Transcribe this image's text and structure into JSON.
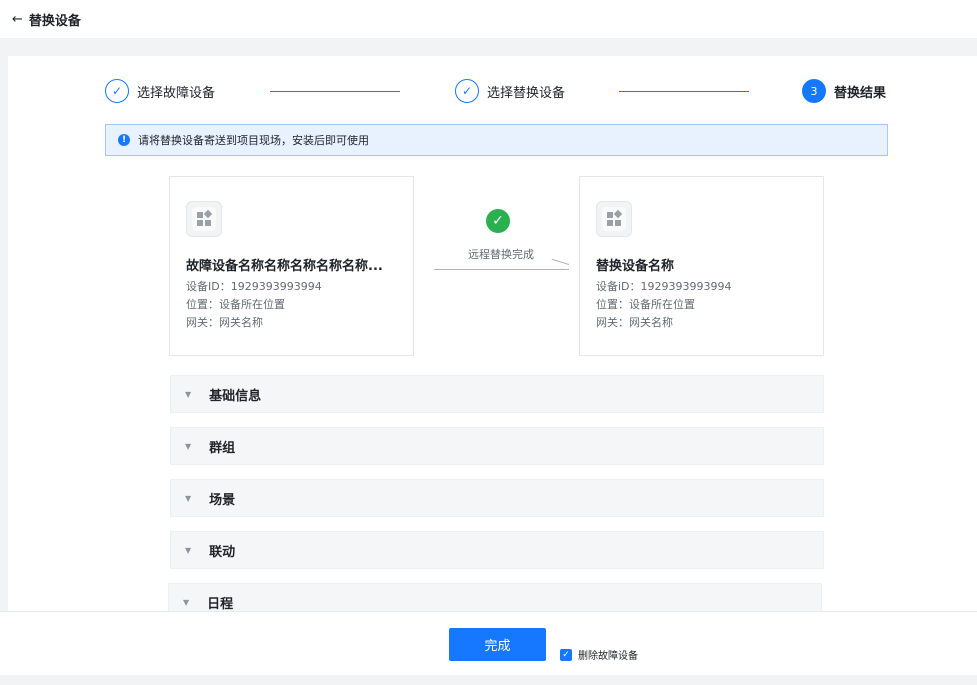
{
  "header": {
    "back_icon": "arrow-left-icon",
    "back_glyph": "←",
    "title": "替换设备"
  },
  "steps": [
    {
      "label": "选择故障设备",
      "state": "done",
      "glyph": "✓"
    },
    {
      "label": "选择替换设备",
      "state": "done",
      "glyph": "✓"
    },
    {
      "label": "替换结果",
      "state": "active",
      "glyph": "3"
    }
  ],
  "notice": {
    "icon": "info-icon",
    "glyph": "!",
    "text": "请将替换设备寄送到项目现场，安装后即可使用"
  },
  "faulty_device": {
    "name": "故障设备名称名称名称名称名称...",
    "id_text": "设备ID：1929393993994",
    "location_text": "位置：设备所在位置",
    "gateway_text": "网关：网关名称"
  },
  "middle": {
    "icon": "check-circle-icon",
    "glyph": "✓",
    "text": "远程替换完成"
  },
  "replacement_device": {
    "name": "替换设备名称",
    "id_text": "设备iD：1929393993994",
    "location_text": "位置：设备所在位置",
    "gateway_text": "网关：网关名称"
  },
  "sections": [
    {
      "label": "基础信息",
      "glyph": "▼"
    },
    {
      "label": "群组",
      "glyph": "▼"
    },
    {
      "label": "场景",
      "glyph": "▼"
    },
    {
      "label": "联动",
      "glyph": "▼"
    },
    {
      "label": "日程",
      "glyph": "▼"
    }
  ],
  "footer": {
    "done_label": "完成",
    "delete_checkbox": {
      "label": "删除故障设备",
      "checked": true,
      "glyph": "✓"
    }
  },
  "colors": {
    "primary": "#1677ff",
    "success": "#2ab04e",
    "notice_bg": "#e8f1fe"
  }
}
